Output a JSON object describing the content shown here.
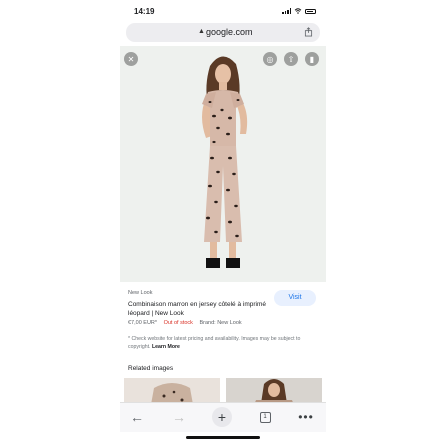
{
  "status_bar": {
    "time": "14:19"
  },
  "address_bar": {
    "url": "google.com",
    "lock_icon": "lock-icon",
    "share_icon": "share-icon"
  },
  "viewer": {
    "buttons": [
      "close-icon",
      "lens-icon",
      "share-icon",
      "bookmark-icon"
    ]
  },
  "result": {
    "source": "New Look",
    "title": "Combinaison marron en jersey côtelé à imprimé léopard | New Look",
    "visit_label": "Visit",
    "price": "€7,00 EUR*",
    "stock": "Out of stock",
    "brand": "Brand: New Look",
    "note_text": "* Check website for latest pricing and availability. Images may be subject to copyright.",
    "learn_more": "Learn More"
  },
  "related": {
    "heading": "Related images"
  },
  "toolbar": {
    "back_icon": "back-arrow-icon",
    "forward_icon": "forward-arrow-icon",
    "new_tab_icon": "plus-icon",
    "tab_count": "1",
    "more_icon": "more-dots-icon"
  }
}
